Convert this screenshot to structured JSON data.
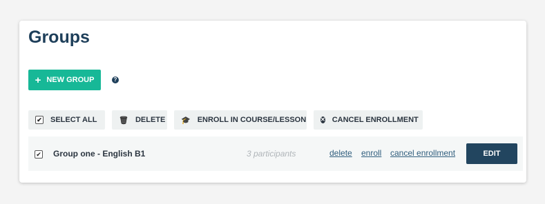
{
  "page": {
    "title": "Groups",
    "new_group_label": "NEW GROUP"
  },
  "toolbar": {
    "select_all": "SELECT ALL",
    "delete": "DELETE",
    "enroll": "ENROLL IN COURSE/LESSON",
    "cancel_enrollment": "CANCEL ENROLLMENT"
  },
  "groups": [
    {
      "name": "Group one - English B1",
      "participants": "3 participants",
      "links": {
        "delete": "delete",
        "enroll": "enroll",
        "cancel_enrollment": "cancel enrollment"
      },
      "edit_label": "EDIT",
      "checked": true
    }
  ],
  "colors": {
    "primary": "#17b897",
    "heading": "#1e3f5a",
    "edit_button": "#22455f",
    "link": "#2f5d7d"
  },
  "icons": {
    "new_group": "plus-icon",
    "help": "question-circle-icon",
    "delete": "trash-icon",
    "enroll": "graduation-cap-icon",
    "cancel": "times-circle-icon"
  }
}
